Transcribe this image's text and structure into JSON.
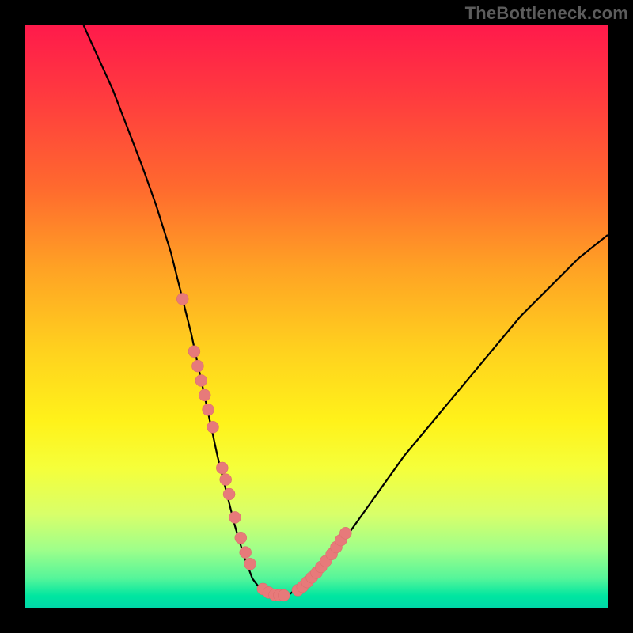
{
  "watermark": {
    "text": "TheBottleneck.com"
  },
  "colors": {
    "frame_bg": "#000000",
    "curve_stroke": "#000000",
    "marker_fill": "#e77a7a",
    "marker_stroke": "#d96a6a"
  },
  "chart_data": {
    "type": "line",
    "title": "",
    "xlabel": "",
    "ylabel": "",
    "xlim": [
      0,
      100
    ],
    "ylim": [
      0,
      100
    ],
    "grid": false,
    "legend": false,
    "series": [
      {
        "name": "curve",
        "x": [
          10,
          15,
          20,
          22.5,
          25,
          27,
          28.5,
          30,
          31.5,
          33,
          34.5,
          36,
          37.5,
          39,
          40.5,
          42,
          45,
          50,
          55,
          60,
          65,
          70,
          75,
          80,
          85,
          90,
          95,
          100
        ],
        "y": [
          100,
          89,
          76,
          69,
          61,
          53,
          47,
          40,
          33,
          26,
          20,
          14,
          9,
          5,
          3,
          2,
          2,
          6,
          12,
          19,
          26,
          32,
          38,
          44,
          50,
          55,
          60,
          64
        ]
      }
    ],
    "markers": {
      "name": "highlight-points",
      "x": [
        27.0,
        29.0,
        29.6,
        30.2,
        30.8,
        31.4,
        32.2,
        33.8,
        34.4,
        35.0,
        36.0,
        37.0,
        37.8,
        38.6,
        40.8,
        41.8,
        42.8,
        43.6,
        44.4,
        46.8,
        47.6,
        48.4,
        49.2,
        50.0,
        50.8,
        51.6,
        52.6,
        53.4,
        54.2,
        55.0
      ],
      "y": [
        53.0,
        44.0,
        41.5,
        39.0,
        36.5,
        34.0,
        31.0,
        24.0,
        22.0,
        19.5,
        15.5,
        12.0,
        9.5,
        7.5,
        3.2,
        2.6,
        2.2,
        2.1,
        2.1,
        3.0,
        3.6,
        4.4,
        5.2,
        6.0,
        7.0,
        8.0,
        9.2,
        10.4,
        11.6,
        12.8
      ]
    }
  }
}
